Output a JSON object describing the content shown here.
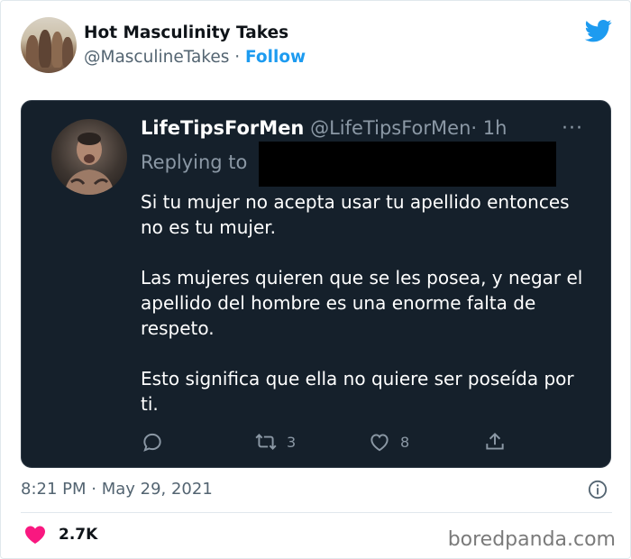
{
  "author": {
    "name": "Hot Masculinity Takes",
    "handle": "@MasculineTakes",
    "separator": "·",
    "follow_label": "Follow"
  },
  "icons": {
    "twitter": "twitter-bird-icon",
    "reply": "reply-icon",
    "retweet": "retweet-icon",
    "like": "heart-icon",
    "share": "share-icon",
    "info": "info-icon",
    "more": "more-icon"
  },
  "quoted_tweet": {
    "name": "LifeTipsForMen",
    "handle": "@LifeTipsForMen",
    "time": "· 1h",
    "more": "···",
    "replying_label": "Replying to",
    "paragraphs": [
      "Si tu mujer no acepta usar tu apellido entonces no es tu mujer.",
      "Las mujeres quieren que se les posea, y negar el apellido del hombre es una enorme falta de respeto.",
      "Esto significa que ella no quiere ser poseída por ti."
    ],
    "actions": {
      "retweets": "3",
      "likes": "8"
    }
  },
  "footer": {
    "timestamp": "8:21 PM · May 29, 2021",
    "like_count": "2.7K",
    "watermark": "boredpanda.com"
  },
  "colors": {
    "twitter_blue": "#1d9bf0",
    "dark_bg": "#15202b",
    "heart": "#f91880",
    "muted": "#536471"
  }
}
